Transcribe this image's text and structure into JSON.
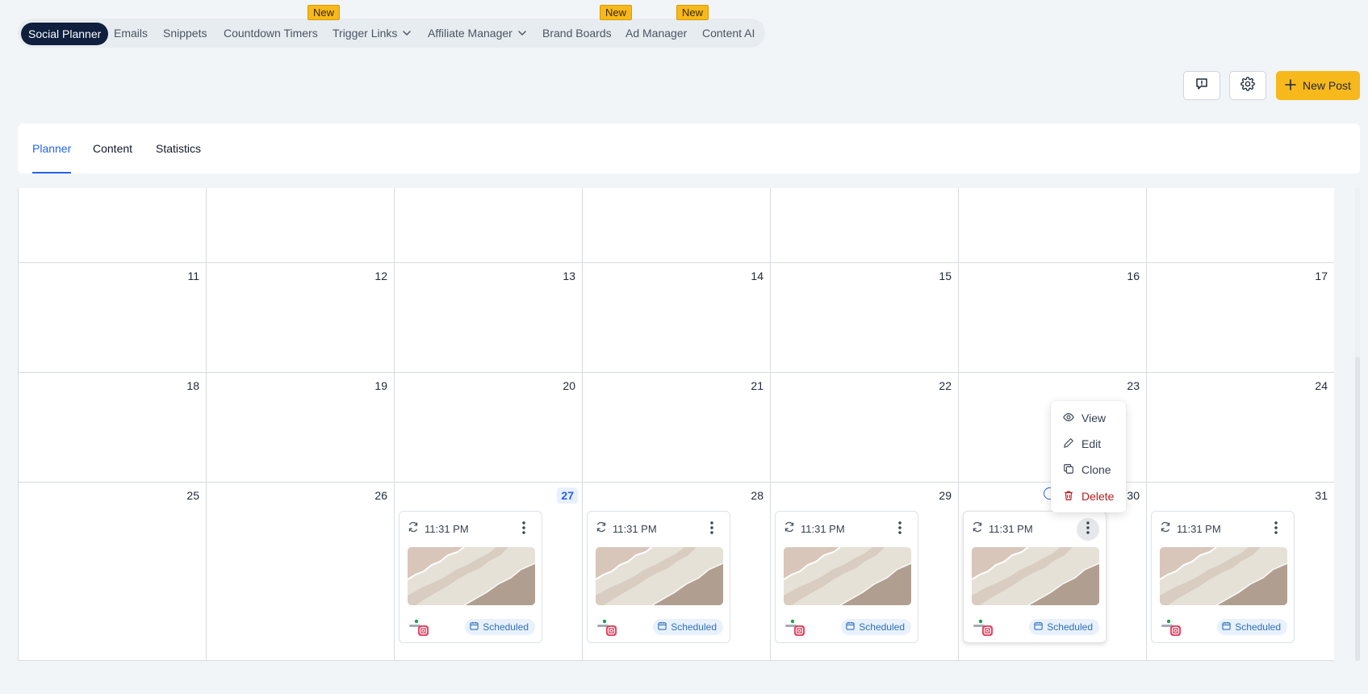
{
  "nav": {
    "items": [
      {
        "label": "Social Planner",
        "active": true
      },
      {
        "label": "Emails"
      },
      {
        "label": "Snippets"
      },
      {
        "label": "Countdown Timers"
      },
      {
        "label": "Trigger Links",
        "dropdown": true
      },
      {
        "label": "Affiliate Manager",
        "dropdown": true
      },
      {
        "label": "Brand Boards"
      },
      {
        "label": "Ad Manager"
      },
      {
        "label": "Content AI"
      }
    ],
    "badges": [
      "New",
      "New",
      "New"
    ]
  },
  "actions": {
    "new_post_label": "New Post"
  },
  "tabs": [
    {
      "label": "Planner",
      "active": true
    },
    {
      "label": "Content"
    },
    {
      "label": "Statistics"
    }
  ],
  "calendar": {
    "weeks": [
      [
        "",
        "",
        "",
        "",
        "",
        "",
        ""
      ],
      [
        "11",
        "12",
        "13",
        "14",
        "15",
        "16",
        "17"
      ],
      [
        "18",
        "19",
        "20",
        "21",
        "22",
        "23",
        "24"
      ],
      [
        "25",
        "26",
        "27",
        "28",
        "29",
        "30",
        "31"
      ]
    ],
    "today": "27"
  },
  "posts": [
    {
      "day": "27",
      "time": "11:31 PM",
      "status": "Scheduled"
    },
    {
      "day": "28",
      "time": "11:31 PM",
      "status": "Scheduled"
    },
    {
      "day": "29",
      "time": "11:31 PM",
      "status": "Scheduled"
    },
    {
      "day": "30",
      "time": "11:31 PM",
      "status": "Scheduled"
    },
    {
      "day": "31",
      "time": "11:31 PM",
      "status": "Scheduled"
    }
  ],
  "context_menu": {
    "view": "View",
    "edit": "Edit",
    "clone": "Clone",
    "delete": "Delete"
  },
  "colors": {
    "accent": "#2563eb",
    "brand_yellow": "#f6b81b",
    "nav_active": "#0f1f3d",
    "danger": "#b91c1c"
  }
}
